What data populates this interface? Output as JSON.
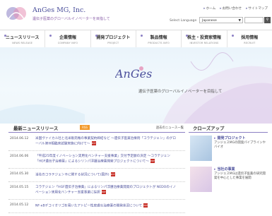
{
  "header": {
    "company_name": "AnGes MG, Inc.",
    "tagline": "遺伝子医薬のグローバルイノベーターを目指して",
    "top_links": [
      "ホーム",
      "お問い合わせ",
      "サイトマップ"
    ],
    "language_label": "Select Language",
    "language_value": "Japanese"
  },
  "nav": [
    {
      "jp": "ニュースリリース",
      "en": "NEWS RELEASE"
    },
    {
      "jp": "企業情報",
      "en": "COMPANY INFO"
    },
    {
      "jp": "開発プロジェクト",
      "en": "PROJECT"
    },
    {
      "jp": "製品情報",
      "en": "PRODUCTS INFO"
    },
    {
      "jp": "株主・投資家情報",
      "en": "INVESTOR RELATIONS"
    },
    {
      "jp": "採用情報",
      "en": "RECRUIT"
    }
  ],
  "hero": {
    "logo_text": "AnGes",
    "tagline": "遺伝子医薬のグローバルイノベーターを目指して"
  },
  "news": {
    "title": "最新ニュースリリース",
    "rss": "RSS",
    "more": "過去のニュース一覧",
    "items": [
      {
        "date": "2014.06.12",
        "text": "米国ヴァイカル社と北米販売権の事業契約締結など ～遺伝子医薬治療剤「コラテジェン」のグローバル第III相臨床試験実施に向けて～"
      },
      {
        "date": "2014.06.06",
        "text": "「平成25年度イノベーション実用化ベンチャー支援事業」交付予定額の決定 ～コラテジェン「HGF遺伝子治療薬」によるシリンパ浮腫治療薬開発プロジェクトについて～"
      },
      {
        "date": "2014.05.30",
        "text": "当社のコラテジェン®に関する状況について(国外)"
      },
      {
        "date": "2014.05.15",
        "text": "コラテジェン「HGF遺伝子治療薬」によるリンパ浮腫治療薬開発のプロジェクトが NEDOのイノベーション実用化ベンチャー支援事業に採択"
      },
      {
        "date": "2014.05.12",
        "text": "NF-κBデコイオリゴを用いたアトピー性皮膚炎治療薬の開発状況について"
      }
    ]
  },
  "closeup": {
    "title": "クローズアップ",
    "cards": [
      {
        "head": "開発プロジェクト",
        "body": "アンジェスMGの開発パイプラインやバイオ"
      },
      {
        "head": "当社の事業",
        "body": "アンジェスMGは遺伝子医薬の研究開発を中心とした事業を展開"
      }
    ]
  }
}
